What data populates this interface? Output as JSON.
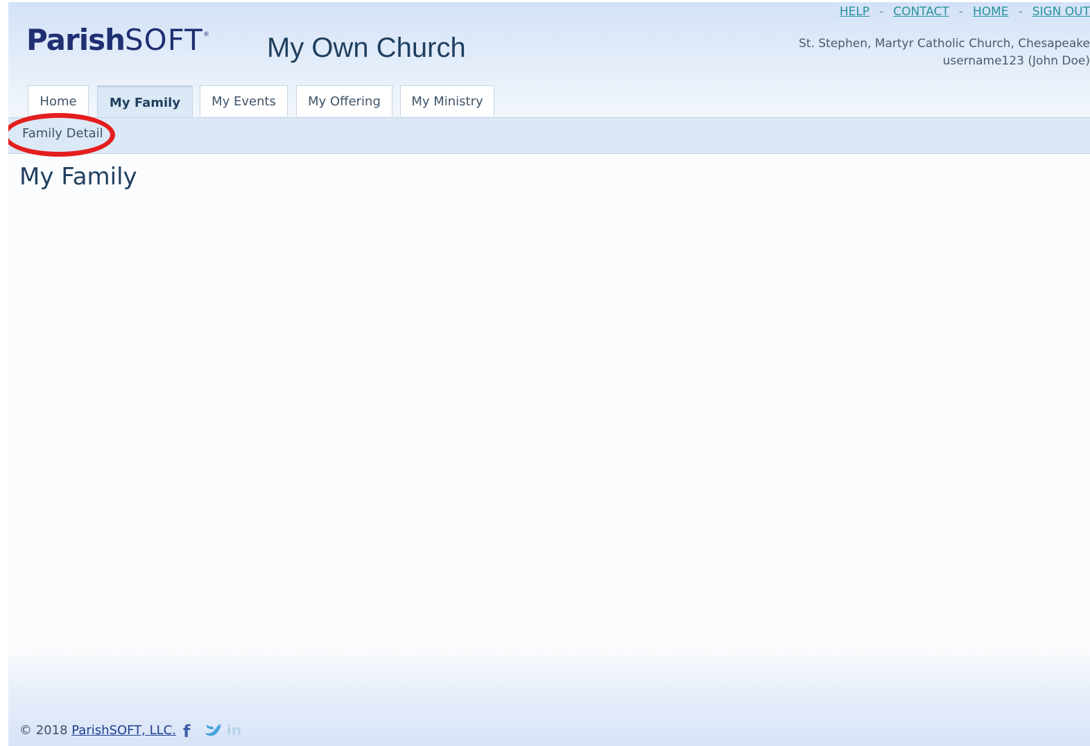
{
  "brand": {
    "logo_part1": "Parish",
    "logo_part2": "SOFT",
    "logo_mark": "®",
    "app_title": "My Own Church"
  },
  "top_links": [
    "HELP",
    "CONTACT",
    "HOME",
    "SIGN OUT"
  ],
  "top_links_separator": "-",
  "church_info": {
    "church_line": "St. Stephen, Martyr Catholic Church, Chesapeake",
    "user_line": "username123 (John Doe)"
  },
  "tabs": [
    {
      "label": "Home",
      "active": false
    },
    {
      "label": "My Family",
      "active": true
    },
    {
      "label": "My Events",
      "active": false
    },
    {
      "label": "My Offering",
      "active": false
    },
    {
      "label": "My Ministry",
      "active": false
    }
  ],
  "subnav": {
    "items": [
      "Family Detail"
    ],
    "highlighted": "Family Detail",
    "highlight_color": "#e41e1e"
  },
  "main": {
    "page_title": "My Family"
  },
  "footer": {
    "copyright": "© 2018",
    "company_link": "ParishSOFT, LLC.",
    "social": [
      "facebook-icon",
      "twitter-icon",
      "linkedin-icon"
    ]
  },
  "colors": {
    "header_gradient_top": "#d3e2f8",
    "nav_bar": "#dbe8f5",
    "link": "#27919c",
    "title_text": "#1f3f5e",
    "logo": "#1f2f72"
  }
}
